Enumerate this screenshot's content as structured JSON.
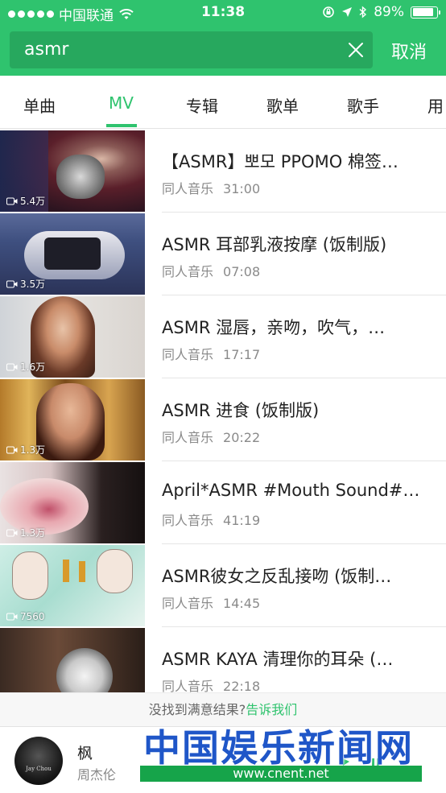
{
  "status": {
    "carrier": "中国联通",
    "time": "11:38",
    "battery": "89%",
    "battery_level": 0.89
  },
  "search": {
    "query": "asmr",
    "cancel_label": "取消"
  },
  "tabs": [
    {
      "label": "单曲"
    },
    {
      "label": "MV",
      "active": true
    },
    {
      "label": "专辑"
    },
    {
      "label": "歌单"
    },
    {
      "label": "歌手"
    },
    {
      "label": "用"
    }
  ],
  "results": [
    {
      "title": "【ASMR】뽀모 PPOMO 棉签…",
      "source": "同人音乐",
      "duration": "31:00",
      "views": "5.4万"
    },
    {
      "title": "ASMR  耳部乳液按摩 (饭制版)",
      "source": "同人音乐",
      "duration": "07:08",
      "views": "3.5万"
    },
    {
      "title": "ASMR 湿唇，亲吻，吹气，…",
      "source": "同人音乐",
      "duration": "17:17",
      "views": "1.6万"
    },
    {
      "title": "ASMR 进食 (饭制版)",
      "source": "同人音乐",
      "duration": "20:22",
      "views": "1.3万"
    },
    {
      "title": "April*ASMR #Mouth Sound#…",
      "source": "同人音乐",
      "duration": "41:19",
      "views": "1.3万"
    },
    {
      "title": "ASMR彼女之反乱接吻 (饭制…",
      "source": "同人音乐",
      "duration": "14:45",
      "views": "7560"
    },
    {
      "title": "ASMR KAYA 清理你的耳朵 (…",
      "source": "同人音乐",
      "duration": "22:18",
      "views": ""
    }
  ],
  "feedback": {
    "prompt": "没找到满意结果?",
    "link": "告诉我们"
  },
  "player": {
    "song": "枫",
    "artist": "周杰伦",
    "cover_text": "Jay Chou"
  },
  "watermark": {
    "title": "中国娱乐新闻网",
    "url": "www.cnent.net"
  },
  "colors": {
    "accent": "#2fc36e",
    "search_bg": "#27a85e",
    "watermark_blue": "#1f56c8",
    "watermark_green": "#16a44a"
  }
}
